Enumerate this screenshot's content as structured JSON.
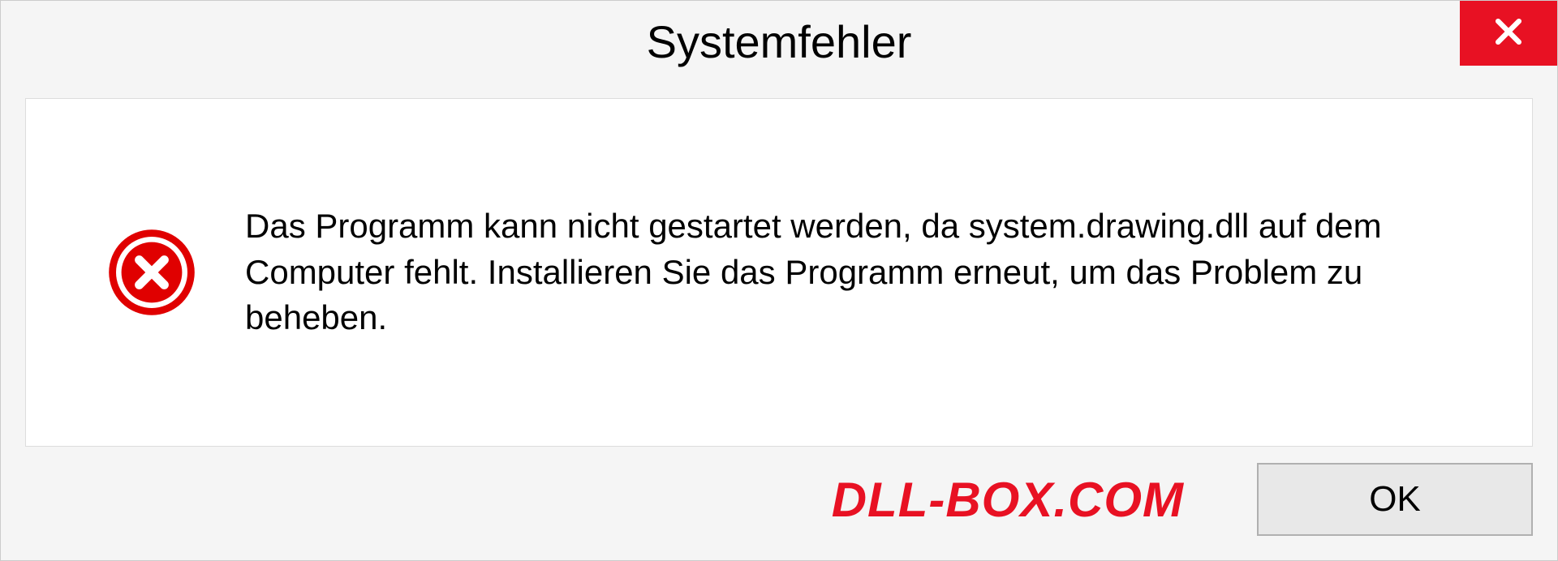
{
  "dialog": {
    "title": "Systemfehler",
    "message": "Das Programm kann nicht gestartet werden, da system.drawing.dll auf dem Computer fehlt. Installieren Sie das Programm erneut, um das Problem zu beheben.",
    "ok_label": "OK"
  },
  "watermark": "DLL-BOX.COM",
  "colors": {
    "close_bg": "#e81123",
    "error_icon": "#e00000",
    "watermark": "#e81123"
  }
}
